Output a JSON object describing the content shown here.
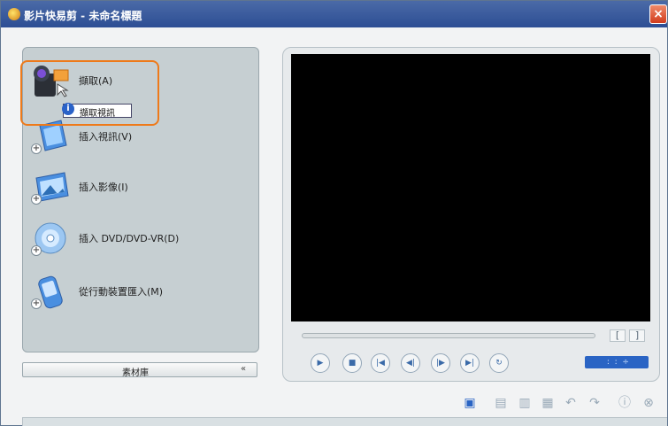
{
  "window": {
    "title": "影片快易剪 - 未命名標題",
    "close_label": "×"
  },
  "left_panel": {
    "items": [
      {
        "label": "擷取(A)",
        "icon": "camcorder-icon"
      },
      {
        "label": "插入視訊(V)",
        "icon": "video-file-icon"
      },
      {
        "label": "插入影像(I)",
        "icon": "image-file-icon"
      },
      {
        "label": "插入 DVD/DVD-VR(D)",
        "icon": "dvd-disc-icon"
      },
      {
        "label": "從行動裝置匯入(M)",
        "icon": "mobile-device-icon"
      }
    ],
    "tooltip": "擷取視訊",
    "library_label": "素材庫",
    "library_toggle": "«"
  },
  "preview": {
    "trim_in": "[",
    "trim_out": "]",
    "controls": [
      {
        "name": "play-button",
        "glyph": "▶"
      },
      {
        "name": "stop-button",
        "glyph": "■"
      },
      {
        "name": "go-to-start-button",
        "glyph": "|◀"
      },
      {
        "name": "previous-frame-button",
        "glyph": "◀|"
      },
      {
        "name": "next-frame-button",
        "glyph": "|▶"
      },
      {
        "name": "go-to-end-button",
        "glyph": "▶|"
      },
      {
        "name": "repeat-button",
        "glyph": "↻"
      }
    ],
    "timecode": " :  :  ÷"
  },
  "colors": {
    "accent_orange": "#ee7a1a",
    "title_blue": "#2d4e94",
    "timecode_blue": "#2a64c4"
  }
}
